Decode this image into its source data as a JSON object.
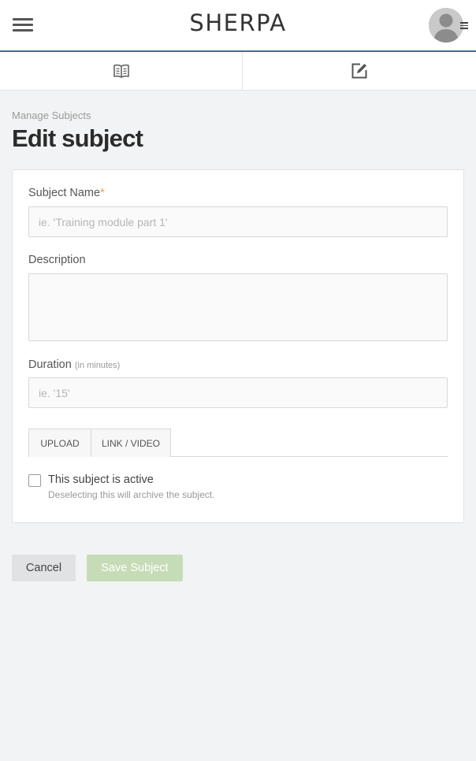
{
  "header": {
    "brand": "SHERPA",
    "menu_icon": "hamburger-icon",
    "avatar_icon": "user-avatar-icon",
    "avatar_menu_icon": "list-icon",
    "accent_color": "#2f6fa8"
  },
  "tabs": [
    {
      "icon": "book-icon",
      "active": false
    },
    {
      "icon": "edit-icon",
      "active": true
    }
  ],
  "page": {
    "breadcrumb": "Manage Subjects",
    "title": "Edit subject"
  },
  "form": {
    "subject_name": {
      "label": "Subject Name",
      "required_mark": "*",
      "placeholder": "ie. 'Training module part 1'",
      "value": ""
    },
    "description": {
      "label": "Description",
      "value": ""
    },
    "duration": {
      "label": "Duration",
      "hint": "(in minutes)",
      "placeholder": "ie. '15'",
      "value": ""
    },
    "media_tabs": [
      "UPLOAD",
      "LINK / VIDEO"
    ],
    "active_checkbox": {
      "checked": false,
      "label": "This subject is active",
      "sublabel": "Deselecting this will archive the subject."
    }
  },
  "actions": {
    "cancel_label": "Cancel",
    "save_label": "Save Subject",
    "save_color": "#c6dcb6"
  }
}
